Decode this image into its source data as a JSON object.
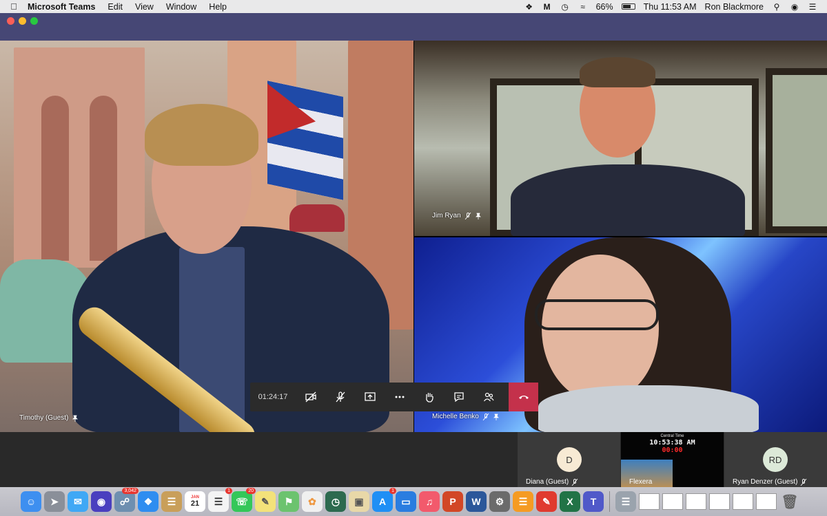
{
  "menubar": {
    "app_name": "Microsoft Teams",
    "menus": [
      "Edit",
      "View",
      "Window",
      "Help"
    ],
    "battery": "66%",
    "clock": "Thu 11:53 AM",
    "user": "Ron Blackmore"
  },
  "meeting": {
    "timer": "01:24:17",
    "participants_on_stage": [
      {
        "name": "Timothy (Guest)"
      },
      {
        "name": "Jim Ryan"
      },
      {
        "name": "Michelle Benko"
      }
    ],
    "strip": [
      {
        "initials": "D",
        "name": "Diana (Guest)",
        "avatar_color": "#f7ead4"
      },
      {
        "name": "Flexera"
      },
      {
        "initials": "RD",
        "name": "Ryan Denzer (Guest)",
        "avatar_color": "#dce9d8"
      }
    ]
  },
  "flexera_clock": {
    "title": "Central Time",
    "time": "10:53:38 AM",
    "counter": "00:00"
  },
  "dock": {
    "badges": {
      "contacts": "3,042",
      "reminders": "1",
      "facetime": "20",
      "appstore": "1"
    },
    "calendar": {
      "month": "JAN",
      "day": "21"
    }
  },
  "colors": {
    "titlebar": "#464775",
    "hangup": "#c4314b",
    "toolbar": "#2b2b2b"
  }
}
